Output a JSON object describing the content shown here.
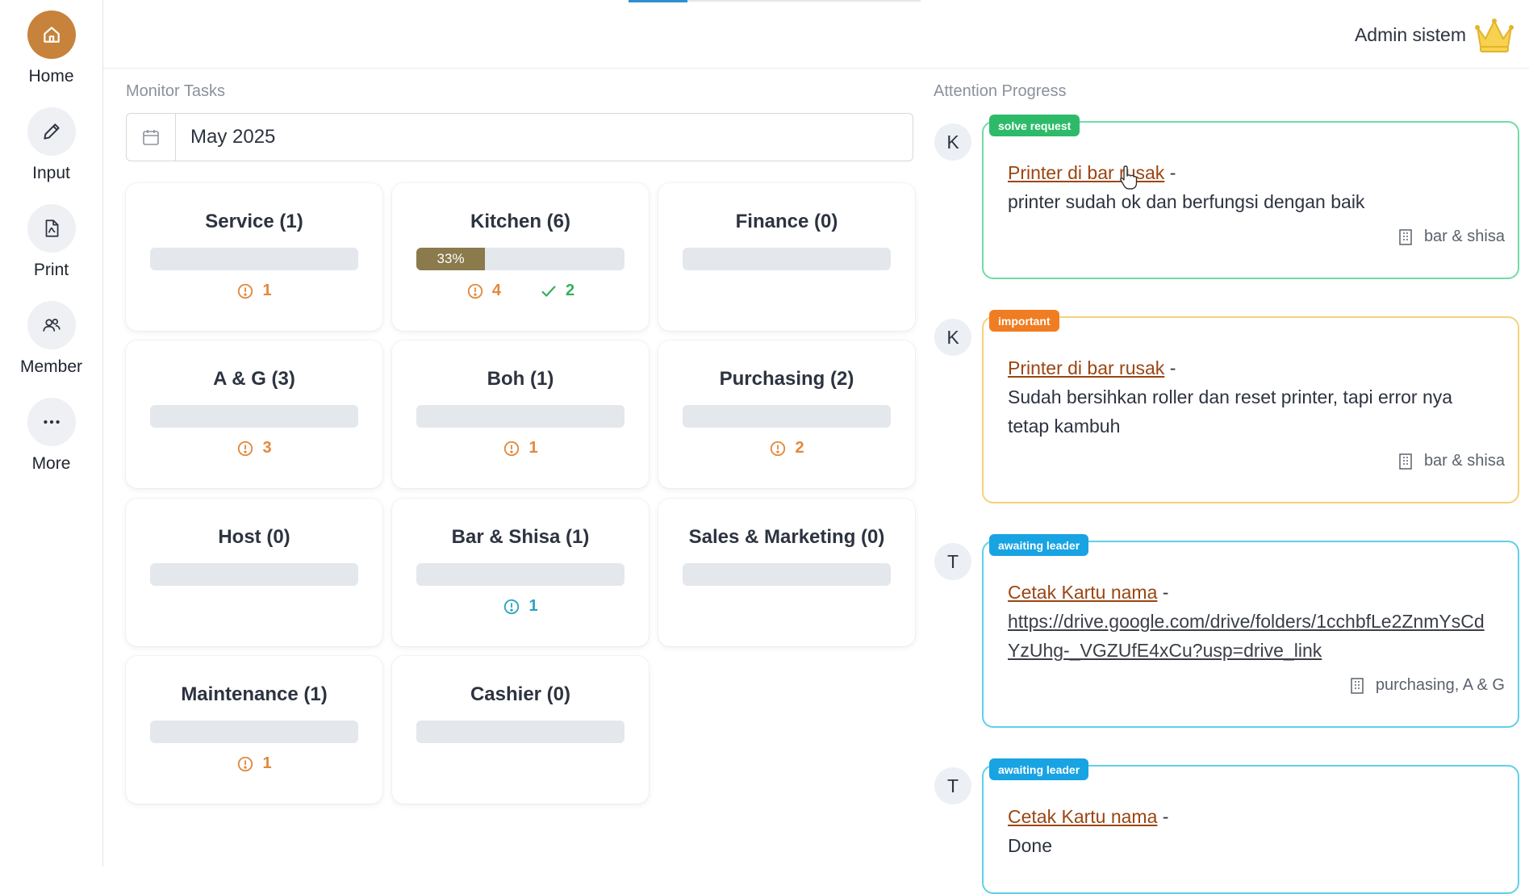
{
  "sidebar": {
    "items": [
      {
        "label": "Home",
        "icon": "home-icon",
        "active": true
      },
      {
        "label": "Input",
        "icon": "pencil-icon",
        "active": false
      },
      {
        "label": "Print",
        "icon": "pdf-file-icon",
        "active": false
      },
      {
        "label": "Member",
        "icon": "users-icon",
        "active": false
      },
      {
        "label": "More",
        "icon": "ellipsis-icon",
        "active": false
      }
    ]
  },
  "header": {
    "user_name": "Admin sistem",
    "user_icon": "crown-icon"
  },
  "monitor": {
    "title": "Monitor Tasks",
    "date_value": "May 2025",
    "departments": [
      {
        "title": "Service (1)",
        "progress_label": "",
        "stats": [
          {
            "type": "warn",
            "value": "1"
          }
        ]
      },
      {
        "title": "Kitchen (6)",
        "progress_label": "33%",
        "progress_percent": 33,
        "stats": [
          {
            "type": "warn",
            "value": "4"
          },
          {
            "type": "done",
            "value": "2"
          }
        ]
      },
      {
        "title": "Finance (0)",
        "progress_label": "",
        "stats": []
      },
      {
        "title": "A & G (3)",
        "progress_label": "",
        "stats": [
          {
            "type": "warn",
            "value": "3"
          }
        ]
      },
      {
        "title": "Boh (1)",
        "progress_label": "",
        "stats": [
          {
            "type": "warn",
            "value": "1"
          }
        ]
      },
      {
        "title": "Purchasing (2)",
        "progress_label": "",
        "stats": [
          {
            "type": "warn",
            "value": "2"
          }
        ]
      },
      {
        "title": "Host (0)",
        "progress_label": "",
        "stats": []
      },
      {
        "title": "Bar & Shisa (1)",
        "progress_label": "",
        "stats": [
          {
            "type": "info",
            "value": "1"
          }
        ]
      },
      {
        "title": "Sales & Marketing (0)",
        "progress_label": "",
        "stats": []
      },
      {
        "title": "Maintenance (1)",
        "progress_label": "",
        "stats": [
          {
            "type": "warn",
            "value": "1"
          }
        ]
      },
      {
        "title": "Cashier (0)",
        "progress_label": "",
        "stats": []
      }
    ]
  },
  "attention": {
    "title": "Attention Progress",
    "items": [
      {
        "avatar": "K",
        "badge": "solve request",
        "badge_color": "#2dbb6a",
        "border_color": "#6fdca6",
        "link": "Printer di bar rusak",
        "separator": " -",
        "description": "printer sudah ok dan berfungsi dengan baik",
        "department": "bar & shisa"
      },
      {
        "avatar": "K",
        "badge": "important",
        "badge_color": "#f07d22",
        "border_color": "#f4d27a",
        "link": "Printer di bar rusak",
        "separator": " -",
        "description": "Sudah bersihkan roller dan reset printer, tapi error nya tetap kambuh",
        "department": "bar & shisa"
      },
      {
        "avatar": "T",
        "badge": "awaiting leader",
        "badge_color": "#18a3e2",
        "border_color": "#5fd0e8",
        "link": "Cetak Kartu nama",
        "separator": " -",
        "description": "https://drive.google.com/drive/folders/1cchbfLe2ZnmYsCdYzUhg-_VGZUfE4xCu?usp=drive_link",
        "department": "purchasing, A & G"
      },
      {
        "avatar": "T",
        "badge": "awaiting leader",
        "badge_color": "#18a3e2",
        "border_color": "#5fd0e8",
        "link": "Cetak Kartu nama",
        "separator": " -",
        "description": "Done",
        "department": ""
      }
    ]
  }
}
